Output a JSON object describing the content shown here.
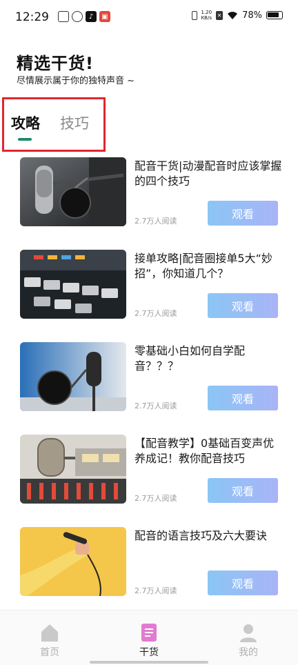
{
  "status_bar": {
    "time": "12:29",
    "net_speed_value": "1.20",
    "net_speed_unit": "KB/s",
    "battery": "78%",
    "icons": [
      "sim-icon",
      "app-icon",
      "tiktok-icon",
      "app-store-icon",
      "vibrate-icon",
      "no-sim-icon",
      "wifi-icon",
      "battery-icon"
    ]
  },
  "header": {
    "title": "精选干货!",
    "subtitle": "尽情展示属于你的独特声音 ~"
  },
  "tabs": [
    {
      "label": "攻略",
      "active": true
    },
    {
      "label": "技巧",
      "active": false
    }
  ],
  "articles": [
    {
      "title": "配音干货|动漫配音时应该掌握的四个技巧",
      "meta": "2.7万人阅读",
      "button": "观看",
      "thumb": "microphone-pop-filter"
    },
    {
      "title": "接单攻略|配音圈接单5大“妙招”，你知道几个？",
      "meta": "2.7万人阅读",
      "button": "观看",
      "thumb": "mixing-console"
    },
    {
      "title": "零基础小白如何自学配音？？？",
      "meta": "2.7万人阅读",
      "button": "观看",
      "thumb": "studio-microphone"
    },
    {
      "title": "【配音教学】0基础百变声优养成记！教你配音技巧",
      "meta": "2.7万人阅读",
      "button": "观看",
      "thumb": "vintage-microphone"
    },
    {
      "title": "配音的语言技巧及六大要诀",
      "meta": "2.7万人阅读",
      "button": "观看",
      "thumb": "hand-microphone"
    }
  ],
  "bottom_nav": [
    {
      "label": "首页",
      "icon": "home-icon",
      "active": false
    },
    {
      "label": "干货",
      "icon": "document-icon",
      "active": true
    },
    {
      "label": "我的",
      "icon": "profile-icon",
      "active": false
    }
  ],
  "colors": {
    "accent": "#1f8a6c",
    "button_start": "#8bc6f5",
    "button_end": "#a9b4f6",
    "highlight": "#e0262c",
    "nav_active": "#e07bd0"
  }
}
